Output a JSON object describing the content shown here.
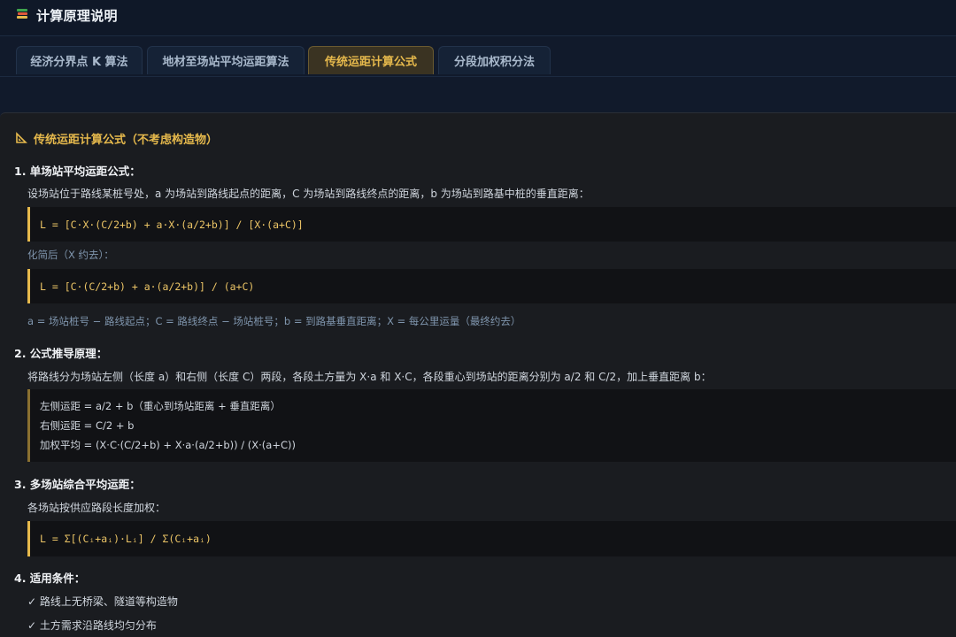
{
  "app": {
    "title": "计算原理说明",
    "icon": "stack-of-books-icon"
  },
  "tabs": [
    {
      "label": "经济分界点 K 算法",
      "active": false
    },
    {
      "label": "地材至场站平均运距算法",
      "active": false
    },
    {
      "label": "传统运距计算公式",
      "active": true
    },
    {
      "label": "分段加权积分法",
      "active": false
    }
  ],
  "section": {
    "icon": "triangle-ruler-icon",
    "title": "传统运距计算公式（不考虑构造物）",
    "h1": "1. 单场站平均运距公式：",
    "p1": "设场站位于路线某桩号处，a 为场站到路线起点的距离，C 为场站到路线终点的距离，b 为场站到路基中桩的垂直距离：",
    "formula1": "L = [C·X·(C/2+b) + a·X·(a/2+b)] / [X·(a+C)]",
    "simplified": "化简后（X 约去）：",
    "formula2": "L = [C·(C/2+b) + a·(a/2+b)] / (a+C)",
    "legend": "a = 场站桩号 − 路线起点；C = 路线终点 − 场站桩号；b = 到路基垂直距离；X = 每公里运量（最终约去）",
    "h2": "2. 公式推导原理：",
    "p2": "将路线分为场站左侧（长度 a）和右侧（长度 C）两段，各段土方量为 X·a 和 X·C，各段重心到场站的距离分别为 a/2 和 C/2，加上垂直距离 b：",
    "deriv": [
      "左侧运距 = a/2 + b（重心到场站距离 + 垂直距离）",
      "右侧运距 = C/2 + b",
      "加权平均 = (X·C·(C/2+b) + X·a·(a/2+b)) / (X·(a+C))"
    ],
    "h3": "3. 多场站综合平均运距：",
    "p3": "各场站按供应路段长度加权：",
    "formula3": "L = Σ[(Cᵢ+aᵢ)·Lᵢ] / Σ(Cᵢ+aᵢ)",
    "h4": "4. 适用条件：",
    "conditions": [
      "✓ 路线上无桥梁、隧道等构造物",
      "✓ 土方需求沿路线均匀分布"
    ]
  },
  "colors": {
    "accent": "#e6b94c",
    "background": "#111a2b",
    "panel": "#1a1c20"
  }
}
